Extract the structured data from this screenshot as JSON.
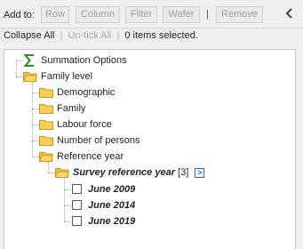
{
  "toolbar": {
    "add_to_label": "Add to:",
    "row_label": "Row",
    "column_label": "Column",
    "filter_label": "Filter",
    "wafer_label": "Wafer",
    "separator": "|",
    "remove_label": "Remove",
    "collapse_icon": "chevron-left-icon"
  },
  "status": {
    "collapse_all": "Collapse All",
    "untick_all": "Un-tick All",
    "selected_text": "0 items selected.",
    "pipe": "|"
  },
  "tree": {
    "summation_options": "Summation Options",
    "family_level": "Family level",
    "children": [
      "Demographic",
      "Family",
      "Labour force",
      "Number of persons",
      "Reference year"
    ],
    "survey_reference_year": "Survey reference year",
    "survey_count": "[3]",
    "expand_glyph": ">",
    "years": [
      "June 2009",
      "June 2014",
      "June 2019"
    ]
  },
  "colors": {
    "folder": "#f7cf54",
    "sigma": "#2b8a2b",
    "link_blue": "#1d6ec3"
  }
}
